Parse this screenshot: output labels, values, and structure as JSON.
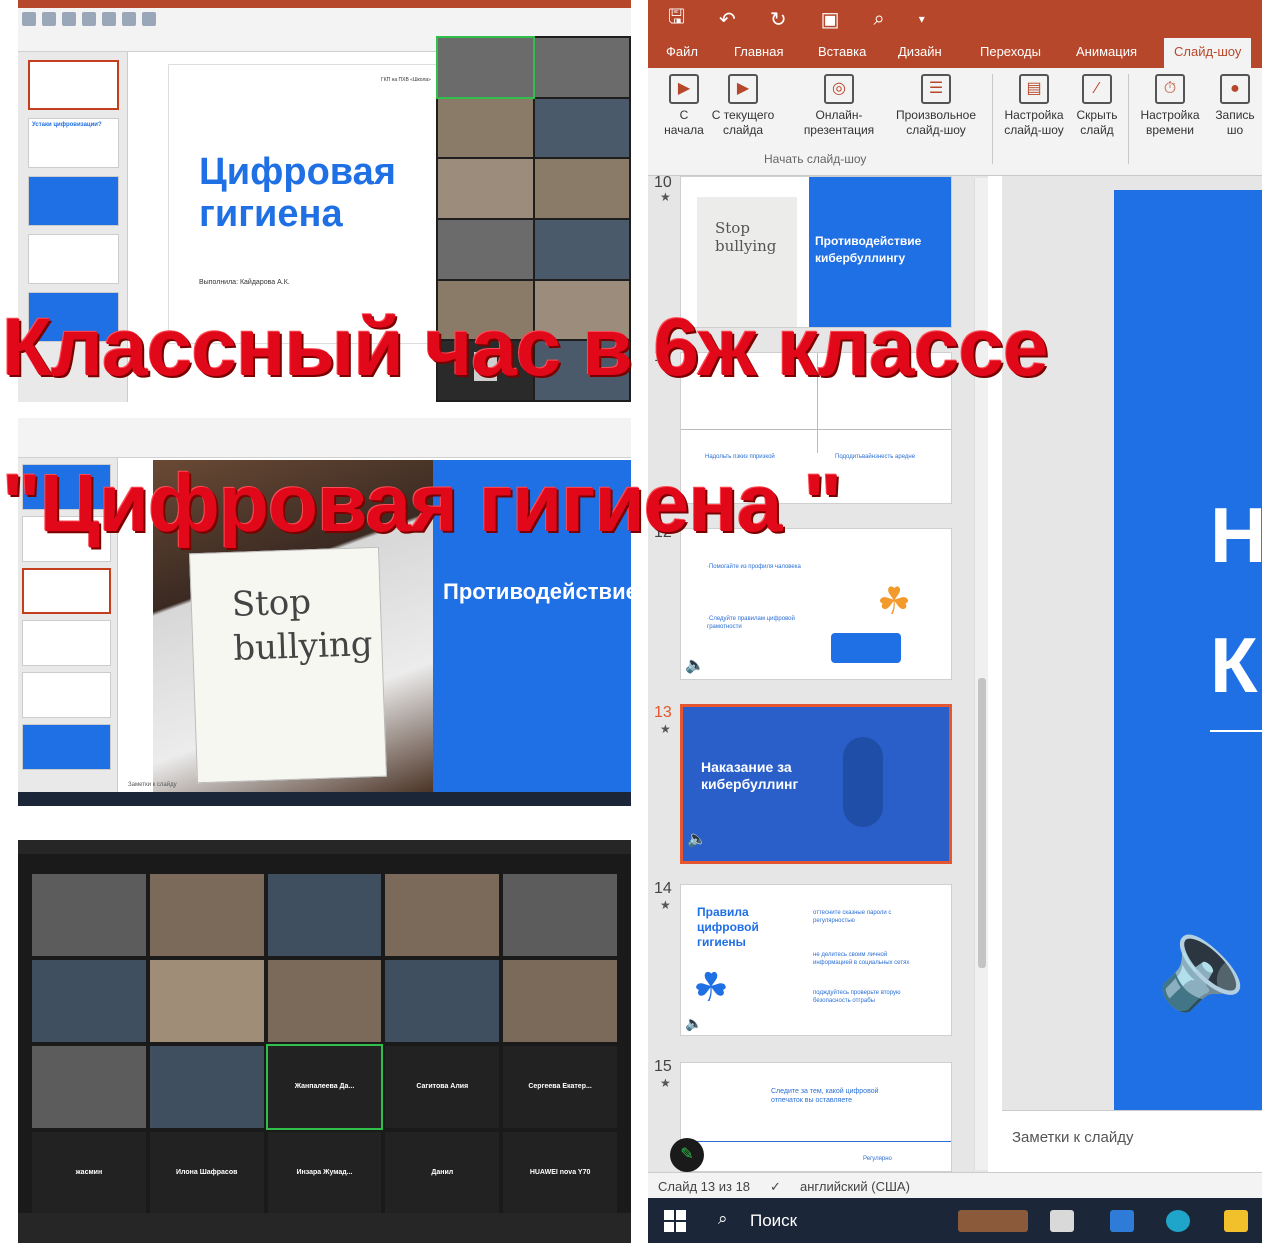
{
  "tile_a": {
    "slide_title": "Цифровая гигиена",
    "slide_author": "Выполнила: Кайдарова А.К.",
    "slide_header": "ГКП на ПХВ «Школа»",
    "thumb_2_label": "Устаки цифровизации?"
  },
  "tile_b": {
    "slide_heading": "Противодействие кибербуллингу",
    "handwriting": "Stop bullying",
    "notes_label": "Заметки к слайду"
  },
  "tile_c": {
    "named_tiles": [
      "Жанпалеева Да...",
      "Сагитова Алия",
      "Сергеева Екатер...",
      "жасмин",
      "Илона Шафрасов",
      "Инзара Жумад...",
      "Данил",
      "HUAWEI nova Y70"
    ]
  },
  "app": {
    "tabs": [
      "Файл",
      "Главная",
      "Вставка",
      "Дизайн",
      "Переходы",
      "Анимация",
      "Слайд-шоу"
    ],
    "active_tab": "Слайд-шоу",
    "ribbon_buttons": [
      {
        "label": "С начала",
        "icon": "play-from-start-icon"
      },
      {
        "label": "С текущего слайда",
        "icon": "play-current-icon"
      },
      {
        "label": "Онлайн-презентация",
        "icon": "present-online-icon"
      },
      {
        "label": "Произвольное слайд-шоу",
        "icon": "custom-show-icon"
      },
      {
        "label": "Настройка слайд-шоу",
        "icon": "setup-show-icon"
      },
      {
        "label": "Скрыть слайд",
        "icon": "hide-slide-icon"
      },
      {
        "label": "Настройка времени",
        "icon": "rehearse-timings-icon"
      },
      {
        "label": "Запись шо",
        "icon": "record-icon"
      }
    ],
    "ribbon_group": "Начать слайд-шоу",
    "slides": [
      {
        "num": "10",
        "title": "Противодействие кибербуллингу",
        "note": "Stop bullying"
      },
      {
        "num": "11",
        "items": [
          "Надольть пзкиз ппризкой",
          "Пододитьвайнзнесть аредне"
        ]
      },
      {
        "num": "12",
        "items": [
          "·Помогайте из профиля чаловека",
          "·Следуйте правилам цифровой грамотности"
        ]
      },
      {
        "num": "13",
        "title": "Наказание за кибербуллинг"
      },
      {
        "num": "14",
        "title": "Правила цифровой гигиены",
        "items": [
          "оттесните сказные пароли с регулярностью",
          "не делитесь своим личной информацией в социальных сетях",
          "подждуйтесь проверьте вторую безопасность отграбы"
        ]
      },
      {
        "num": "15",
        "title": "Следите за тем, какой цифровой отпечаток вы оставляете",
        "items": [
          "Регулярно"
        ]
      }
    ],
    "big_slide_glyphs": [
      "Н",
      "К"
    ],
    "notes_placeholder": "Заметки к слайду",
    "status_slide": "Слайд 13 из 18",
    "status_language": "английский (США)",
    "taskbar_search": "Поиск"
  },
  "captions": {
    "line1": "Классный час в 6ж классе",
    "line2": "\"Цифровая гигиена \""
  },
  "colors": {
    "ppt_accent": "#b7472a",
    "slide_blue": "#1f6fe5",
    "caption_red": "#e1081a",
    "selection": "#e4562f"
  }
}
